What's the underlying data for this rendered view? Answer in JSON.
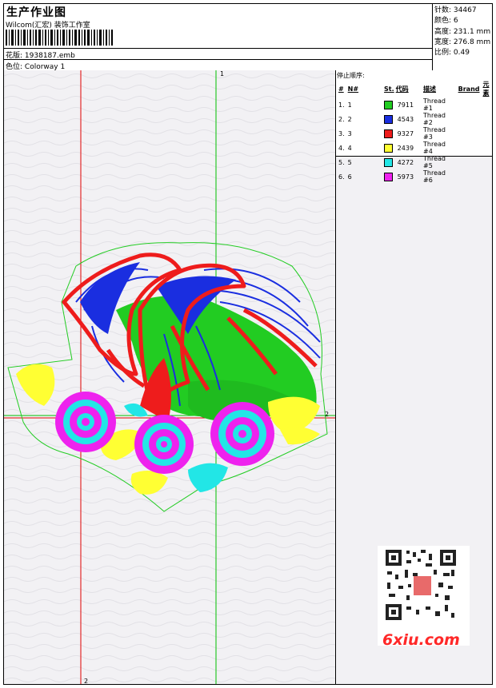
{
  "header": {
    "title": "生产作业图",
    "company": "Wilcom(汇宏) 装饰工作室",
    "file_label": "花版:",
    "file_value": "1938187.emb",
    "colorway_label": "色位:",
    "colorway_value": "Colorway 1"
  },
  "stats": [
    {
      "label": "针数:",
      "value": "34467"
    },
    {
      "label": "颜色:",
      "value": "6"
    },
    {
      "label": "高度:",
      "value": "231.1 mm"
    },
    {
      "label": "宽度:",
      "value": "276.8 mm"
    },
    {
      "label": "比例:",
      "value": "0.49"
    }
  ],
  "threads": {
    "title": "停止顺序:",
    "columns": [
      "#",
      "N#",
      "St.",
      "代码",
      "描述",
      "Brand",
      "元素"
    ],
    "rows": [
      {
        "num": "1.",
        "n": "1",
        "color": "#22cc22",
        "code": "7911",
        "desc": "Thread #1"
      },
      {
        "num": "2.",
        "n": "2",
        "color": "#1a2ee0",
        "code": "4543",
        "desc": "Thread #2"
      },
      {
        "num": "3.",
        "n": "3",
        "color": "#ee1c1c",
        "code": "9327",
        "desc": "Thread #3"
      },
      {
        "num": "4.",
        "n": "4",
        "color": "#ffff33",
        "code": "2439",
        "desc": "Thread #4"
      },
      {
        "num": "5.",
        "n": "5",
        "color": "#22e6e6",
        "code": "4272",
        "desc": "Thread #5"
      },
      {
        "num": "6.",
        "n": "6",
        "color": "#ee22ee",
        "code": "5973",
        "desc": "Thread #6"
      }
    ]
  },
  "markers": {
    "top": "1",
    "right": "2",
    "bottom": "2"
  },
  "watermark": "6xiu.com",
  "colors": {
    "guide_red": "#e00000",
    "guide_green": "#00c000",
    "outline_green": "#22cc22"
  }
}
